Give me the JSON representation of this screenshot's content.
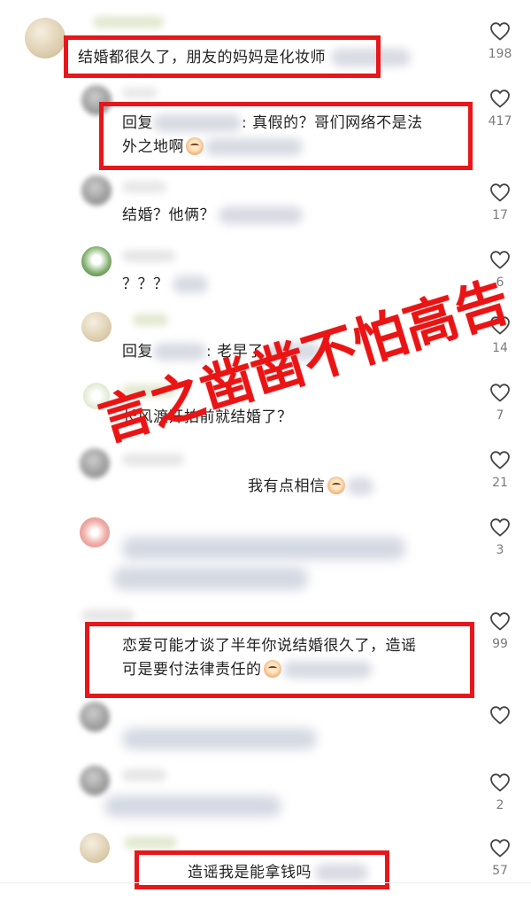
{
  "comments": [
    {
      "text": "结婚都很久了，朋友的妈妈是化妆师",
      "likes": "198"
    },
    {
      "reply_prefix": "回复",
      "text_after": ": 真假的？哥们网络不是法",
      "text_line2": "外之地啊",
      "likes": "417"
    },
    {
      "text": "结婚？他俩？",
      "likes": "17"
    },
    {
      "text": "？？？",
      "likes": "6"
    },
    {
      "reply_prefix": "回复",
      "text_after": ": 老早了",
      "likes": "14"
    },
    {
      "text": "长风渡开拍前就结婚了？",
      "likes": "7"
    },
    {
      "text": "我有点相信",
      "likes": "21"
    },
    {
      "text": "",
      "likes": "3"
    },
    {
      "text": "恋爱可能才谈了半年你说结婚很久了，造谣",
      "text_line2": "可是要付法律责任的",
      "likes": "99"
    },
    {
      "text": "",
      "likes": ""
    },
    {
      "text": "",
      "likes": "2"
    },
    {
      "text": "造谣我是能拿钱吗",
      "likes": "57"
    }
  ],
  "watermark": {
    "text": "言之凿凿不怕高告"
  },
  "colors": {
    "highlight": "#e8161b",
    "watermark": "#ea1414",
    "count": "#7b7b7b"
  },
  "icons": {
    "like": "heart-outline-icon"
  }
}
